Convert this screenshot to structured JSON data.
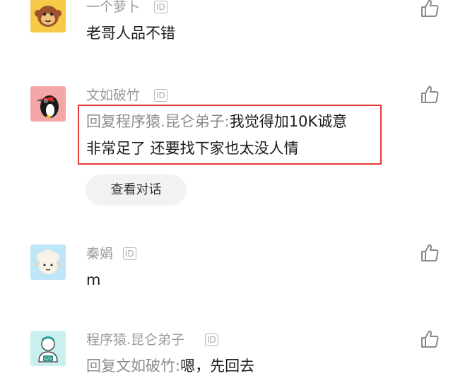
{
  "comments": [
    {
      "username": "一个萝卜",
      "id_badge": "ID",
      "text": "老哥人品不错",
      "avatar_icon": "monkey-avatar-icon"
    },
    {
      "username": "文如破竹",
      "id_badge": "ID",
      "reply_prefix": "回复程序猿.昆仑弟子:",
      "text_line1": "我觉得加10K诚意",
      "text_line2": "非常足了 还要找下家也太没人情",
      "view_conversation": "查看对话",
      "avatar_icon": "woodpecker-avatar-icon",
      "highlighted": true
    },
    {
      "username": "秦娟",
      "id_badge": "ID",
      "text": "m",
      "avatar_icon": "sheep-avatar-icon"
    },
    {
      "username": "程序猿.昆仑弟子",
      "id_badge": "ID",
      "reply_prefix": "回复文如破竹:",
      "text": "嗯，先回去",
      "avatar_icon": "programmer-avatar-icon"
    }
  ],
  "colors": {
    "username": "#9a9a9a",
    "text": "#1c1c1c",
    "highlight_border": "#e53935",
    "button_bg": "#f2f2f2"
  }
}
